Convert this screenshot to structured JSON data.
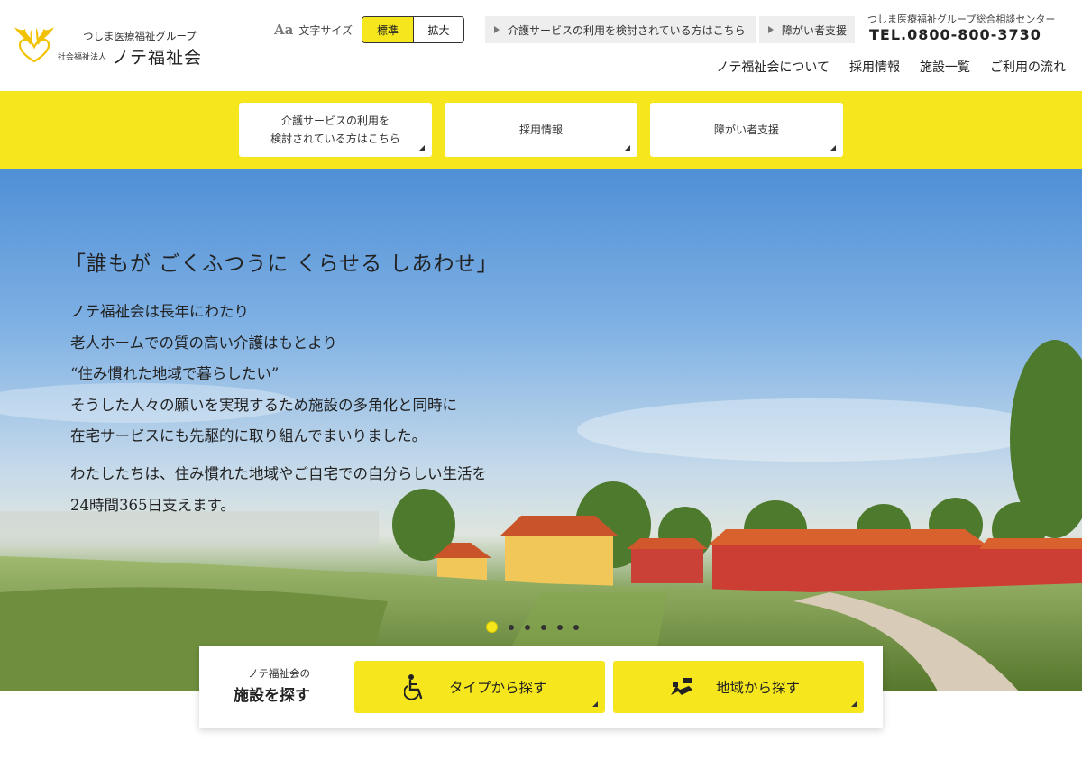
{
  "org": {
    "group_name": "つしま医療福祉グループ",
    "corp_type": "社会福祉法人",
    "name": "ノテ福祉会"
  },
  "font_size": {
    "icon": "Aa",
    "label": "文字サイズ",
    "options": [
      "標準",
      "拡大"
    ],
    "selected": "標準"
  },
  "top_links": [
    {
      "label": "介護サービスの利用を検討されている方はこちら"
    },
    {
      "label": "障がい者支援"
    }
  ],
  "hotline": {
    "label": "つしま医療福祉グループ総合相談センター",
    "phone": "TEL.0800-800-3730"
  },
  "nav": [
    "ノテ福祉会について",
    "採用情報",
    "施設一覧",
    "ご利用の流れ"
  ],
  "band_cards": [
    {
      "line1": "介護サービスの利用を",
      "line2": "検討されている方はこちら"
    },
    {
      "line1": "採用情報",
      "line2": ""
    },
    {
      "line1": "障がい者支援",
      "line2": ""
    }
  ],
  "hero": {
    "headline": "「誰もが ごくふつうに くらせる しあわせ」",
    "lines": [
      "ノテ福祉会は長年にわたり",
      "老人ホームでの質の高い介護はもとより",
      "“住み慣れた地域で暮らしたい”",
      "そうした人々の願いを実現するため施設の多角化と同時に",
      "在宅サービスにも先駆的に取り組んでまいりました。"
    ],
    "lines2": [
      "わたしたちは、住み慣れた地域やご自宅での自分らしい生活を",
      "24時間365日支えます。"
    ],
    "slide_count": 6,
    "active_slide": 1
  },
  "facility_search": {
    "small": "ノテ福祉会の",
    "big": "施設を探す",
    "buttons": [
      {
        "label": "タイプから探す",
        "icon": "wheelchair-icon"
      },
      {
        "label": "地域から探す",
        "icon": "map-icon"
      }
    ]
  },
  "colors": {
    "accent_yellow": "#f6e61d"
  }
}
